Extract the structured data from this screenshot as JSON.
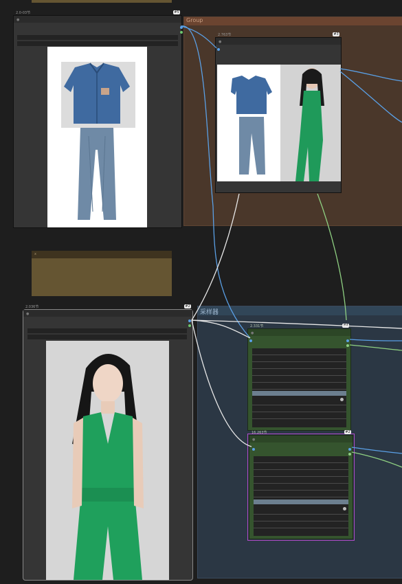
{
  "group_top": {
    "title": "Group"
  },
  "group_bottom": {
    "title": "采样器"
  },
  "node_clothes": {
    "title": "2.0-03节",
    "badge": "#5"
  },
  "node_compare": {
    "title": "2.763节",
    "badge": "#3"
  },
  "node_model": {
    "title": "2.036节",
    "badge": "#2"
  },
  "node_ks1": {
    "title": "2.331节",
    "badge": "#4"
  },
  "node_ks2": {
    "title": "16.263节",
    "badge": "#2"
  },
  "note": {
    "header": "x"
  },
  "colors": {
    "canvas": "#1e1e1e",
    "group_brown": "#4a372a",
    "group_blue": "#2b3744",
    "ksampler_green": "#35542e",
    "wire_blue": "#5aa0e6",
    "wire_white": "#e8e8e8",
    "wire_green": "#8fd082",
    "selected_outline": "#b04cc8"
  }
}
